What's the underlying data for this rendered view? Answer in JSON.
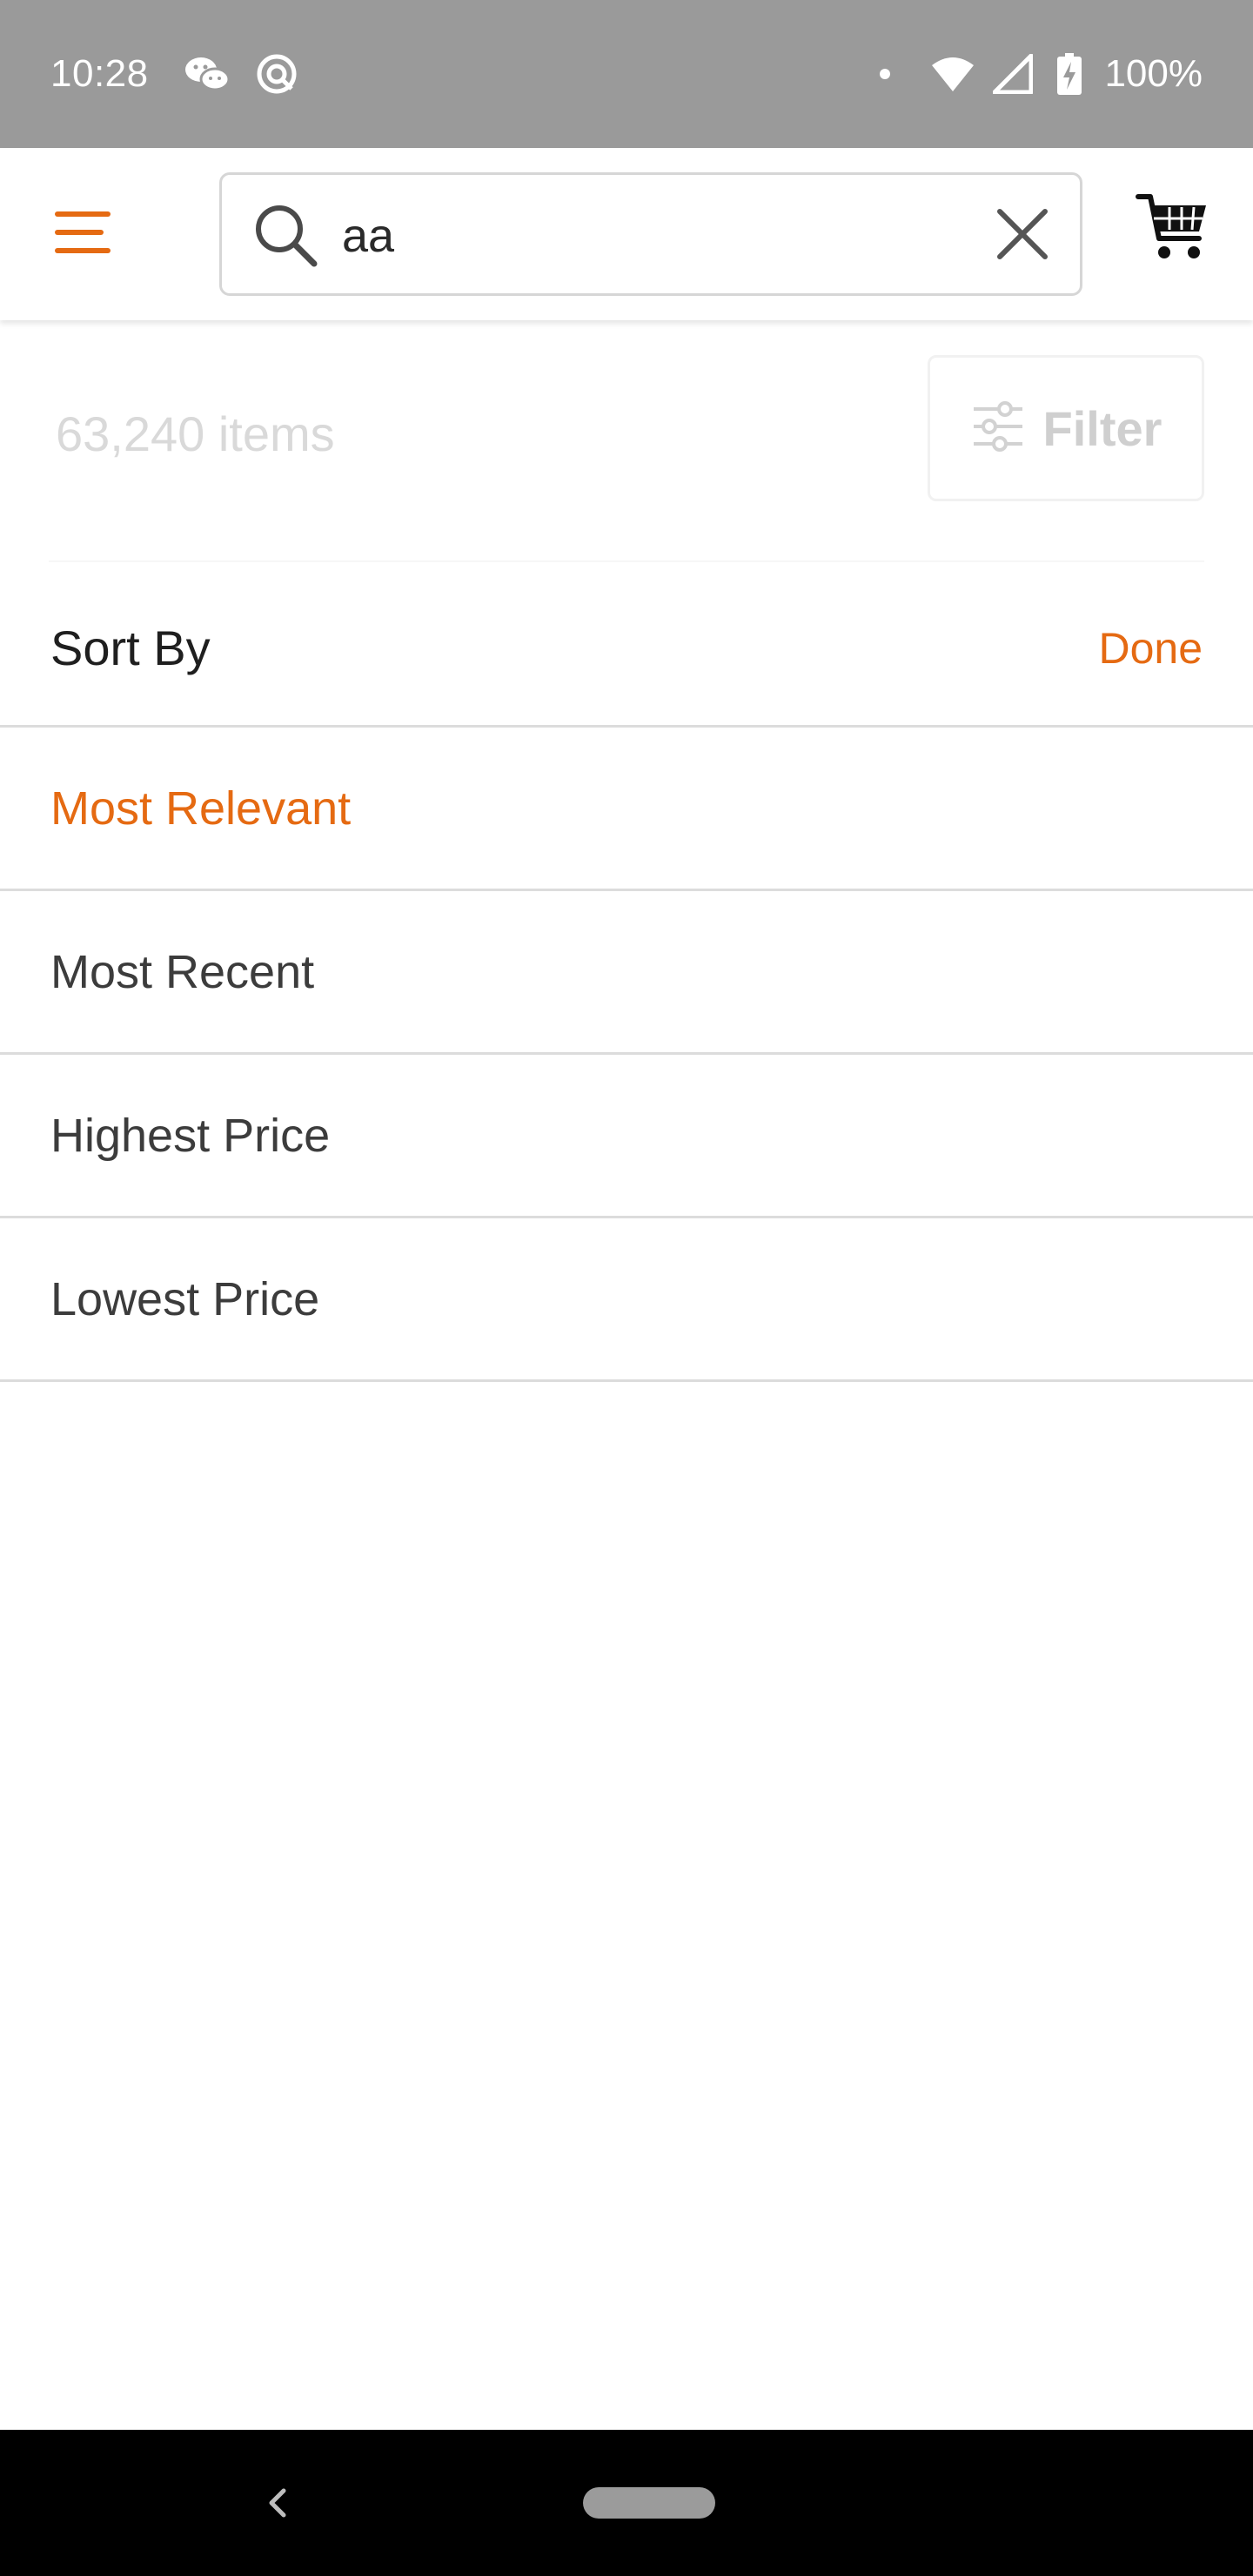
{
  "status_bar": {
    "time": "10:28",
    "left_icons": [
      "wechat-icon",
      "vpn-icon"
    ],
    "right_icons": [
      "dot-icon",
      "wifi-icon",
      "signal-icon",
      "battery-charging-icon"
    ],
    "battery": "100%"
  },
  "header": {
    "menu_icon": "hamburger-menu-icon",
    "search": {
      "value": "aa",
      "placeholder": ""
    },
    "cart_icon": "shopping-cart-icon"
  },
  "results": {
    "count_text": "63,240 items",
    "filter_label": "Filter"
  },
  "sort": {
    "title": "Sort By",
    "done_label": "Done",
    "options": [
      {
        "label": "Most Relevant",
        "selected": true
      },
      {
        "label": "Most Recent",
        "selected": false
      },
      {
        "label": "Highest Price",
        "selected": false
      },
      {
        "label": "Lowest Price",
        "selected": false
      }
    ]
  },
  "colors": {
    "accent": "#e56a12",
    "status_bar": "#9a9a9a",
    "divider": "#dcdcdc",
    "dim_text": "#d9d9d9"
  }
}
